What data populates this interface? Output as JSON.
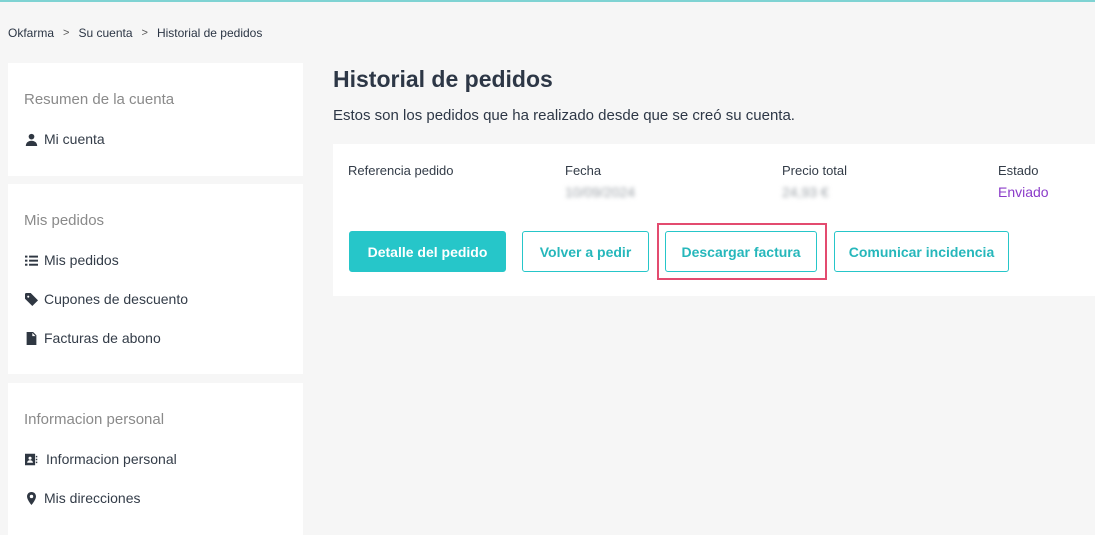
{
  "breadcrumb": {
    "items": [
      "Okfarma",
      "Su cuenta",
      "Historial de pedidos"
    ],
    "separator": ">"
  },
  "sidebar": {
    "section1": {
      "title": "Resumen de la cuenta",
      "items": [
        {
          "label": "Mi cuenta",
          "icon": "user-icon"
        }
      ]
    },
    "section2": {
      "title": "Mis pedidos",
      "items": [
        {
          "label": "Mis pedidos",
          "icon": "list-icon"
        },
        {
          "label": "Cupones de descuento",
          "icon": "tag-icon"
        },
        {
          "label": "Facturas de abono",
          "icon": "document-icon"
        }
      ]
    },
    "section3": {
      "title": "Informacion personal",
      "items": [
        {
          "label": "Informacion personal",
          "icon": "contact-card-icon"
        },
        {
          "label": "Mis direcciones",
          "icon": "map-pin-icon"
        }
      ]
    }
  },
  "main": {
    "title": "Historial de pedidos",
    "subtitle": "Estos son los pedidos que ha realizado desde que se creó su cuenta."
  },
  "order": {
    "headers": {
      "reference": "Referencia pedido",
      "date": "Fecha",
      "total": "Precio total",
      "status": "Estado"
    },
    "values": {
      "date": "10/09/2024",
      "total": "24,93 €",
      "status": "Enviado"
    },
    "buttons": {
      "detail": "Detalle del pedido",
      "reorder": "Volver a pedir",
      "invoice": "Descargar factura",
      "incident": "Comunicar incidencia"
    }
  },
  "colors": {
    "accent": "#26c6c9",
    "status": "#8b3cc9",
    "highlight": "#e34b6f"
  }
}
